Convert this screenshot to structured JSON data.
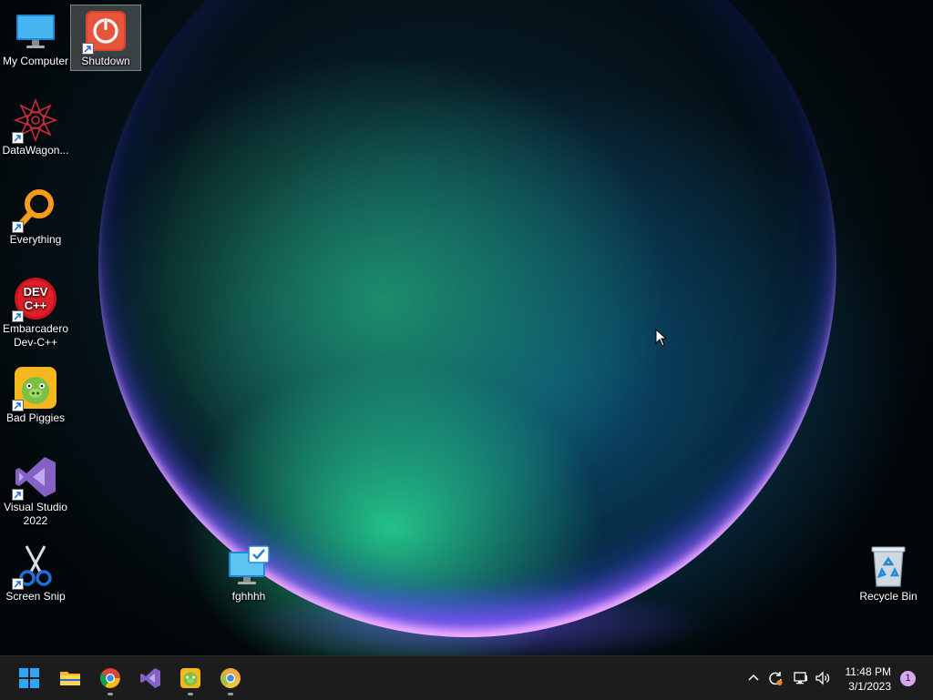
{
  "desktop": {
    "icons": [
      {
        "label": "My Computer",
        "icon": "monitor-icon"
      },
      {
        "label": "Shutdown",
        "icon": "power-icon"
      },
      {
        "label": "DataWagon...",
        "icon": "datawagon-icon"
      },
      {
        "label": "Everything",
        "icon": "magnifier-icon"
      },
      {
        "label": "Embarcadero Dev-C++",
        "icon": "devcpp-icon"
      },
      {
        "label": "Bad Piggies",
        "icon": "bad-piggies-icon"
      },
      {
        "label": "Visual Studio 2022",
        "icon": "visual-studio-icon"
      },
      {
        "label": "Screen Snip",
        "icon": "scissors-icon"
      },
      {
        "label": "fghhhh",
        "icon": "monitor-check-icon"
      },
      {
        "label": "Recycle Bin",
        "icon": "recycle-bin-icon"
      }
    ],
    "devcpp_badge": "DEV C++"
  },
  "taskbar": {
    "apps": [
      "start-icon",
      "file-explorer-icon",
      "chrome-icon",
      "visual-studio-icon",
      "bad-piggies-icon",
      "chrome-canary-icon"
    ],
    "tray": [
      "show-hidden-icons-chevron",
      "sync-icon",
      "network-icon",
      "volume-icon"
    ],
    "time": "11:48 PM",
    "date": "3/1/2023",
    "notification_count": "1"
  },
  "colors": {
    "taskbar": "#1c1c1c",
    "accent_blue": "#0a84ff",
    "notification_badge": "#d7a8f0"
  }
}
